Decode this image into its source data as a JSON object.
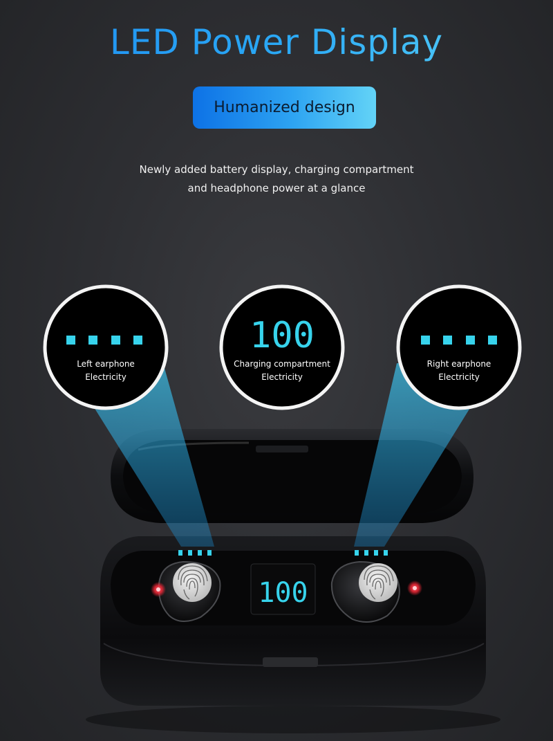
{
  "header": {
    "title": "LED Power Display",
    "badge": "Humanized design",
    "description_line1": "Newly added battery display, charging compartment",
    "description_line2": "and headphone power at a glance"
  },
  "callouts": {
    "left": {
      "line1": "Left earphone",
      "line2": "Electricity"
    },
    "center": {
      "reading": "100",
      "line1": "Charging compartment",
      "line2": "Electricity"
    },
    "right": {
      "line1": "Right earphone",
      "line2": "Electricity"
    }
  },
  "case_display": {
    "reading": "100"
  },
  "colors": {
    "accent": "#2aa8f5",
    "led": "#37d3ec",
    "indicator": "#ff2a3a",
    "background": "#2e2f33"
  }
}
